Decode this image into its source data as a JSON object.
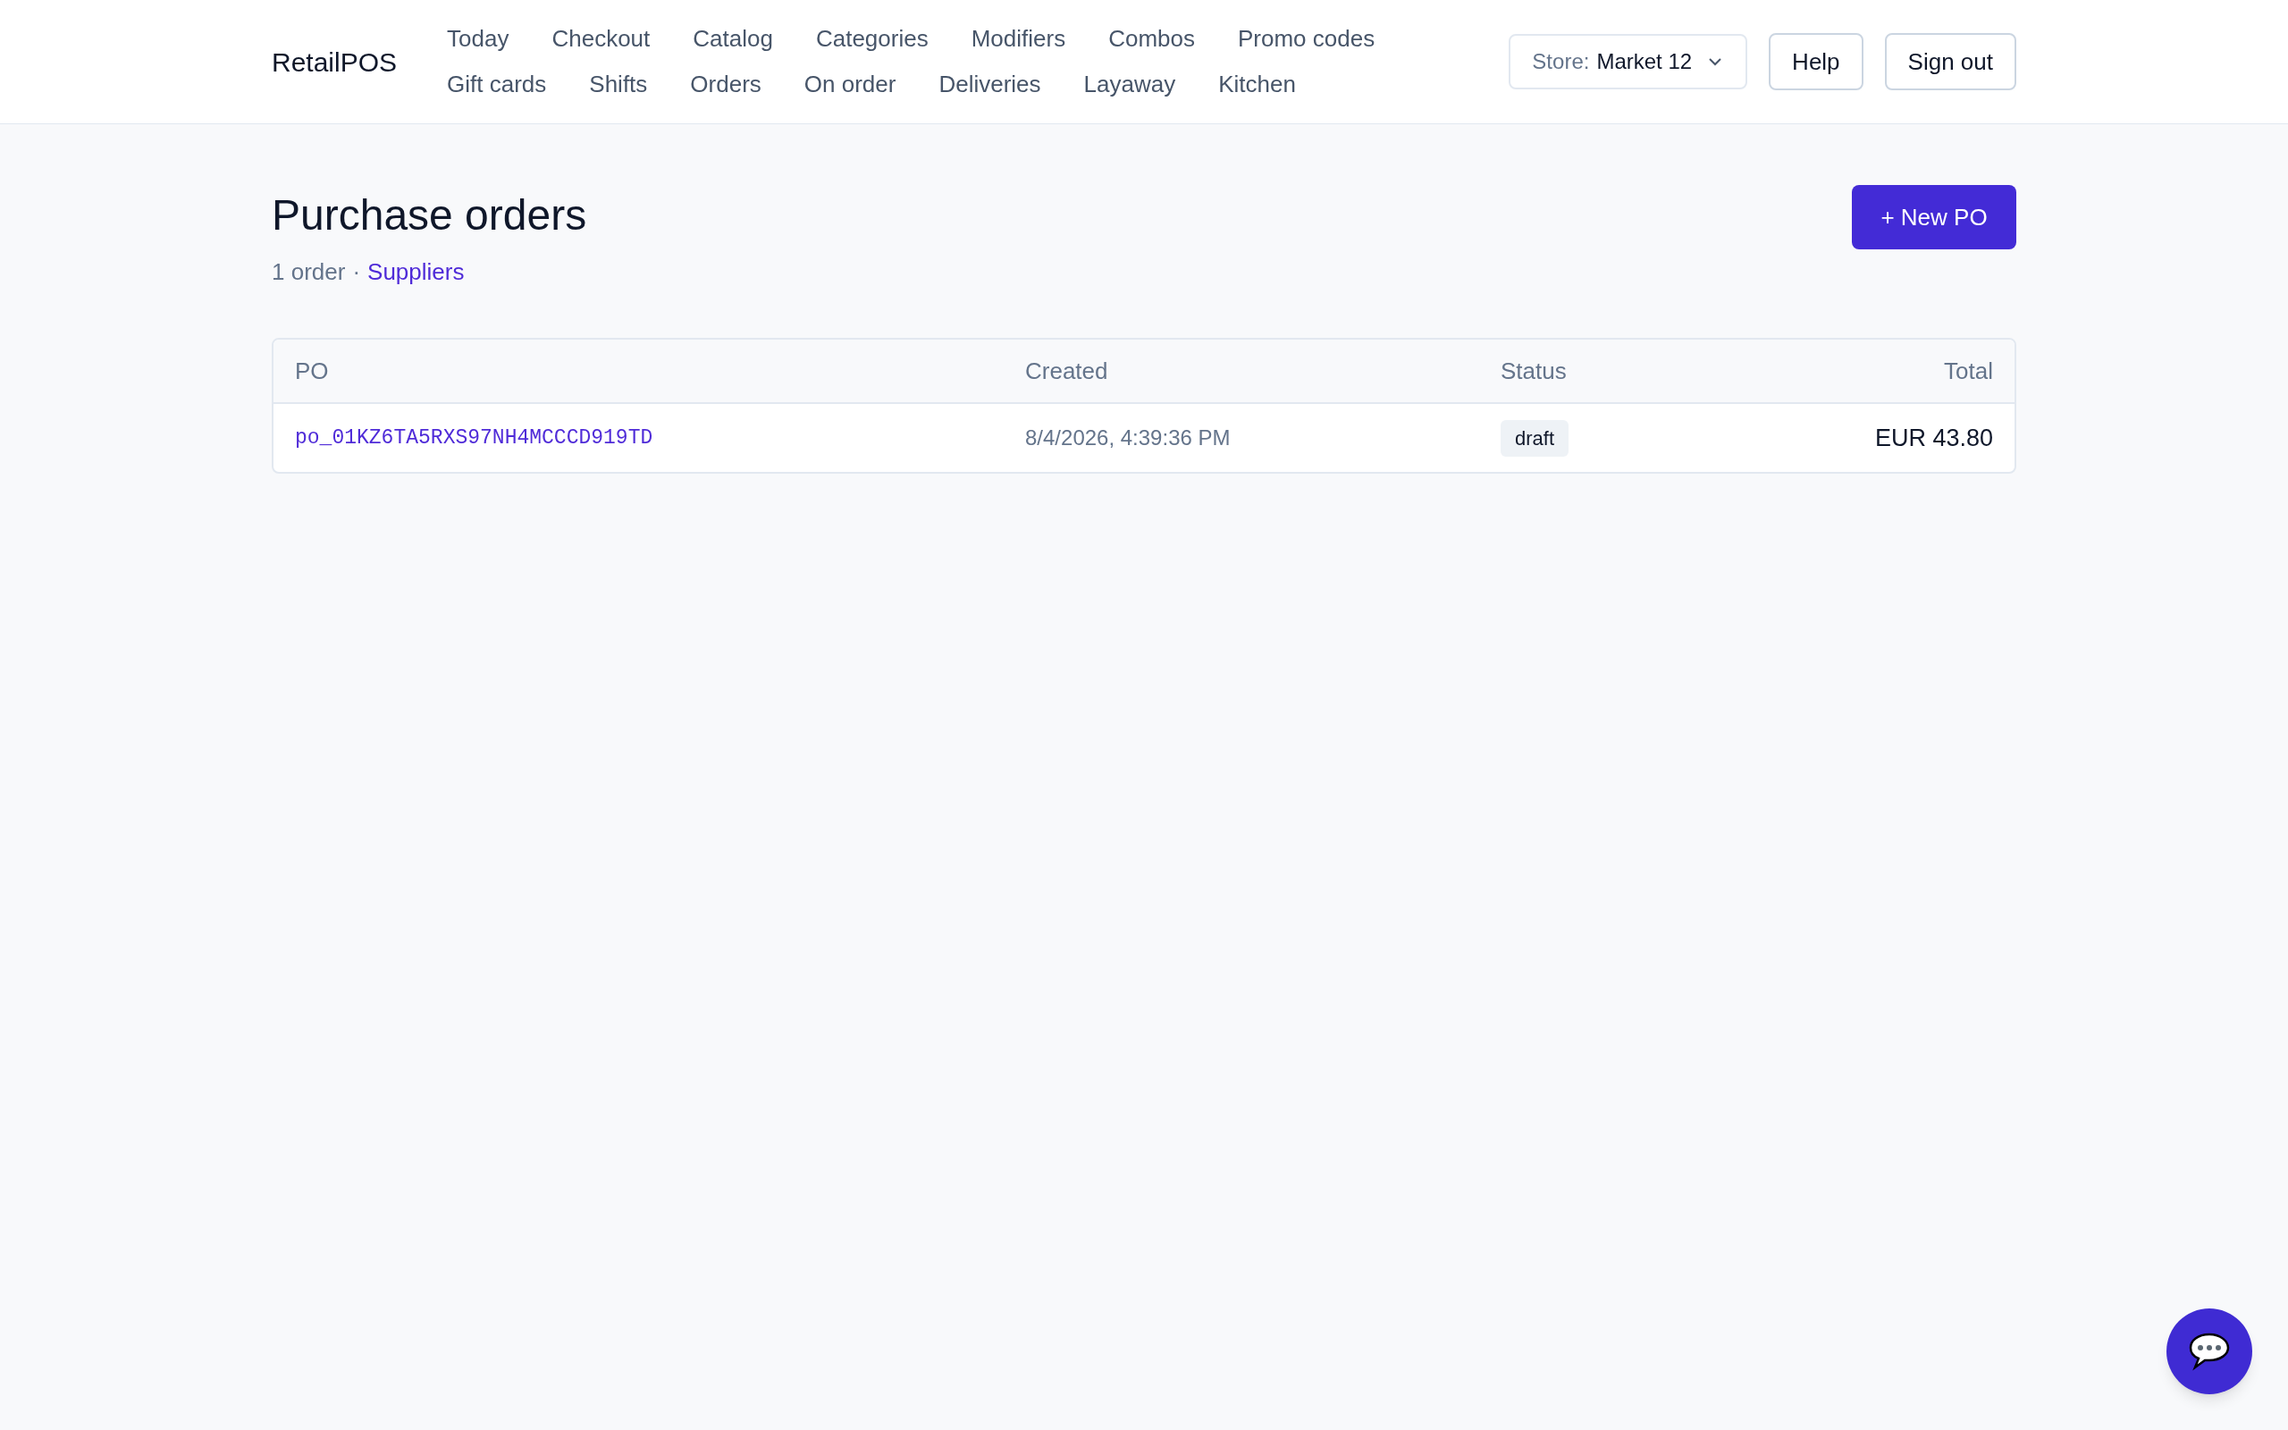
{
  "brand": "RetailPOS",
  "nav": [
    {
      "label": "Today"
    },
    {
      "label": "Checkout"
    },
    {
      "label": "Catalog"
    },
    {
      "label": "Categories"
    },
    {
      "label": "Modifiers"
    },
    {
      "label": "Combos"
    },
    {
      "label": "Promo codes"
    },
    {
      "label": "Gift cards"
    },
    {
      "label": "Shifts"
    },
    {
      "label": "Orders"
    },
    {
      "label": "On order"
    },
    {
      "label": "Deliveries"
    },
    {
      "label": "Layaway"
    },
    {
      "label": "Kitchen"
    }
  ],
  "store_select": {
    "label": "Store:",
    "value": "Market 12"
  },
  "header_buttons": [
    "Help",
    "Sign out"
  ],
  "page": {
    "title": "Purchase orders",
    "count": "1 order",
    "separator": "·",
    "link": "Suppliers",
    "new_button": "+ New PO"
  },
  "table": {
    "columns": [
      {
        "label": "PO"
      },
      {
        "label": "Created"
      },
      {
        "label": "Status"
      },
      {
        "label": "Total"
      }
    ],
    "rows": [
      {
        "po": "po_01KZ6TA5RXS97NH4MCCCD919TD",
        "created": "8/4/2026, 4:39:36 PM",
        "status": "draft",
        "total": "EUR 43.80"
      }
    ]
  }
}
